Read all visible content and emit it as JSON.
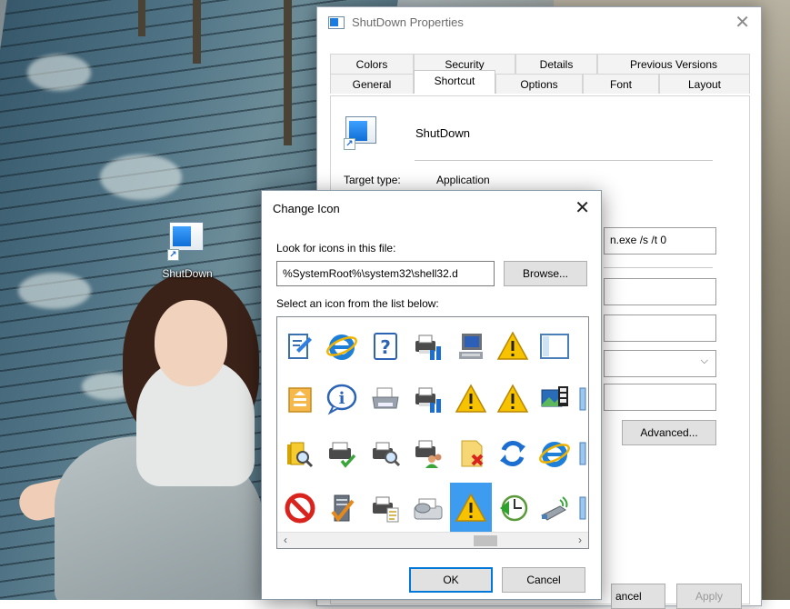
{
  "desktop": {
    "shortcut_label": "ShutDown"
  },
  "properties": {
    "title": "ShutDown Properties",
    "tabs_top": [
      "Colors",
      "Security",
      "Details",
      "Previous Versions"
    ],
    "tabs_bottom": [
      "General",
      "Shortcut",
      "Options",
      "Font",
      "Layout"
    ],
    "active_tab": "Shortcut",
    "shortcut_name": "ShutDown",
    "target_type_label": "Target type:",
    "target_type_value": "Application",
    "target_value": "n.exe /s /t 0",
    "advanced_button": "Advanced...",
    "cancel_button": "ancel",
    "apply_button": "Apply"
  },
  "change_icon": {
    "title": "Change Icon",
    "close_glyph": "✕",
    "look_label": "Look for icons in this file:",
    "path_value": "%SystemRoot%\\system32\\shell32.d",
    "browse_button": "Browse...",
    "select_label": "Select an icon from the list below:",
    "ok_button": "OK",
    "cancel_button": "Cancel",
    "selected_icon": "warning-icon",
    "icons": [
      [
        "document-edit-icon",
        "internet-explorer-icon",
        "help-icon",
        "printer-network-icon",
        "computer-icon",
        "warning-icon",
        "window-icon",
        "shield-icon"
      ],
      [
        "stack-icon",
        "info-icon",
        "printer-icon",
        "printer-network-icon",
        "warning-icon",
        "warning-icon",
        "photo-film-icon",
        "partial-icon"
      ],
      [
        "folder-search-icon",
        "printer-check-icon",
        "printer-search-icon",
        "printer-people-icon",
        "document-delete-icon",
        "refresh-icon",
        "internet-explorer-icon",
        "partial-icon"
      ],
      [
        "no-entry-icon",
        "server-check-icon",
        "printer-doc-icon",
        "fax-icon",
        "warning-icon",
        "clock-globe-icon",
        "usb-wireless-icon",
        "partial-icon"
      ]
    ]
  },
  "colors": {
    "accent": "#0078d7",
    "selected_cell": "#3d9cf0",
    "warning_yellow": "#f7c300",
    "ie_blue": "#1e7fd8"
  }
}
